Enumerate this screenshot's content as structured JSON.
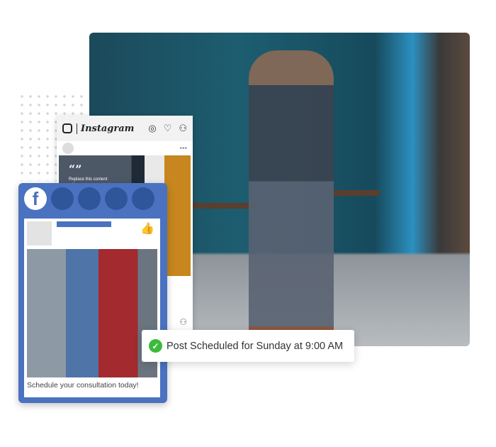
{
  "instagram": {
    "brand": "Instagram",
    "icons": [
      "instagram-logo-icon",
      "compass-icon",
      "heart-icon",
      "user-icon"
    ],
    "post_text": "Replace this content with your own content. Content",
    "quote_mark": "“”"
  },
  "facebook": {
    "brand_letter": "f",
    "caption": "Schedule your consultation today!",
    "accent": "#4a72c0"
  },
  "toast": {
    "message": "Post Scheduled for Sunday at 9:00 AM",
    "status_color": "#3cba3c",
    "icon": "check-circle-icon"
  }
}
